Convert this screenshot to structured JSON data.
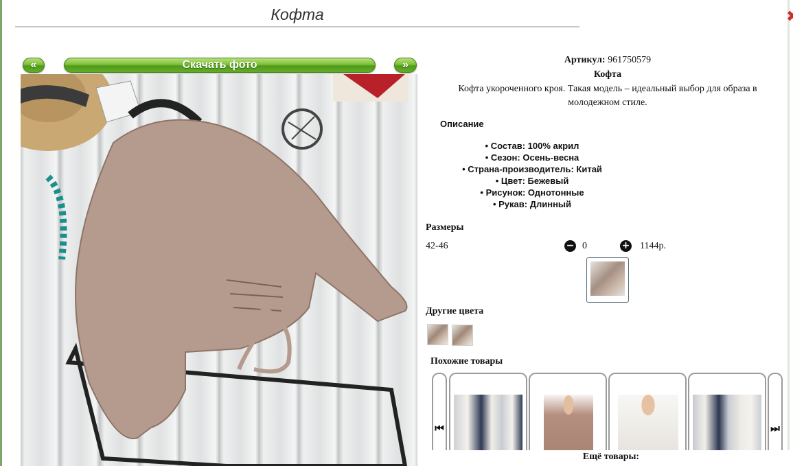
{
  "page": {
    "title": "Кофта",
    "close_glyph": "✖"
  },
  "photo_nav": {
    "prev_label": "«",
    "download_label": "Скачать фото",
    "next_label": "»"
  },
  "product": {
    "article_label": "Артикул:",
    "article_value": "961750579",
    "name": "Кофта",
    "description": "Кофта укороченного кроя. Такая модель – идеальный выбор для образа в молодежном стиле."
  },
  "description_section": {
    "heading": "Описание",
    "specs": [
      "Состав: 100% акрил",
      "Сезон: Осень-весна",
      "Страна-производитель: Китай",
      "Цвет: Бежевый",
      "Рисунок: Однотонные",
      "Рукав: Длинный"
    ]
  },
  "sizes": {
    "heading": "Размеры",
    "rows": [
      {
        "size": "42-46",
        "minus": "−",
        "quantity": "0",
        "plus": "+",
        "price": "1144р."
      }
    ]
  },
  "other_colors": {
    "heading": "Другие цвета",
    "count": 2
  },
  "similar": {
    "heading": "Похожие товары",
    "prev_glyph": "⏮",
    "next_glyph": "⏭",
    "count": 4
  },
  "more_label": "Ещё товары:",
  "colors": {
    "accent_green": "#64ad27",
    "sweater": "#b49a8c",
    "close_red": "#d52a2a"
  },
  "icons": [
    "close-icon",
    "minus-icon",
    "plus-icon",
    "skip-back-icon",
    "skip-forward-icon"
  ]
}
